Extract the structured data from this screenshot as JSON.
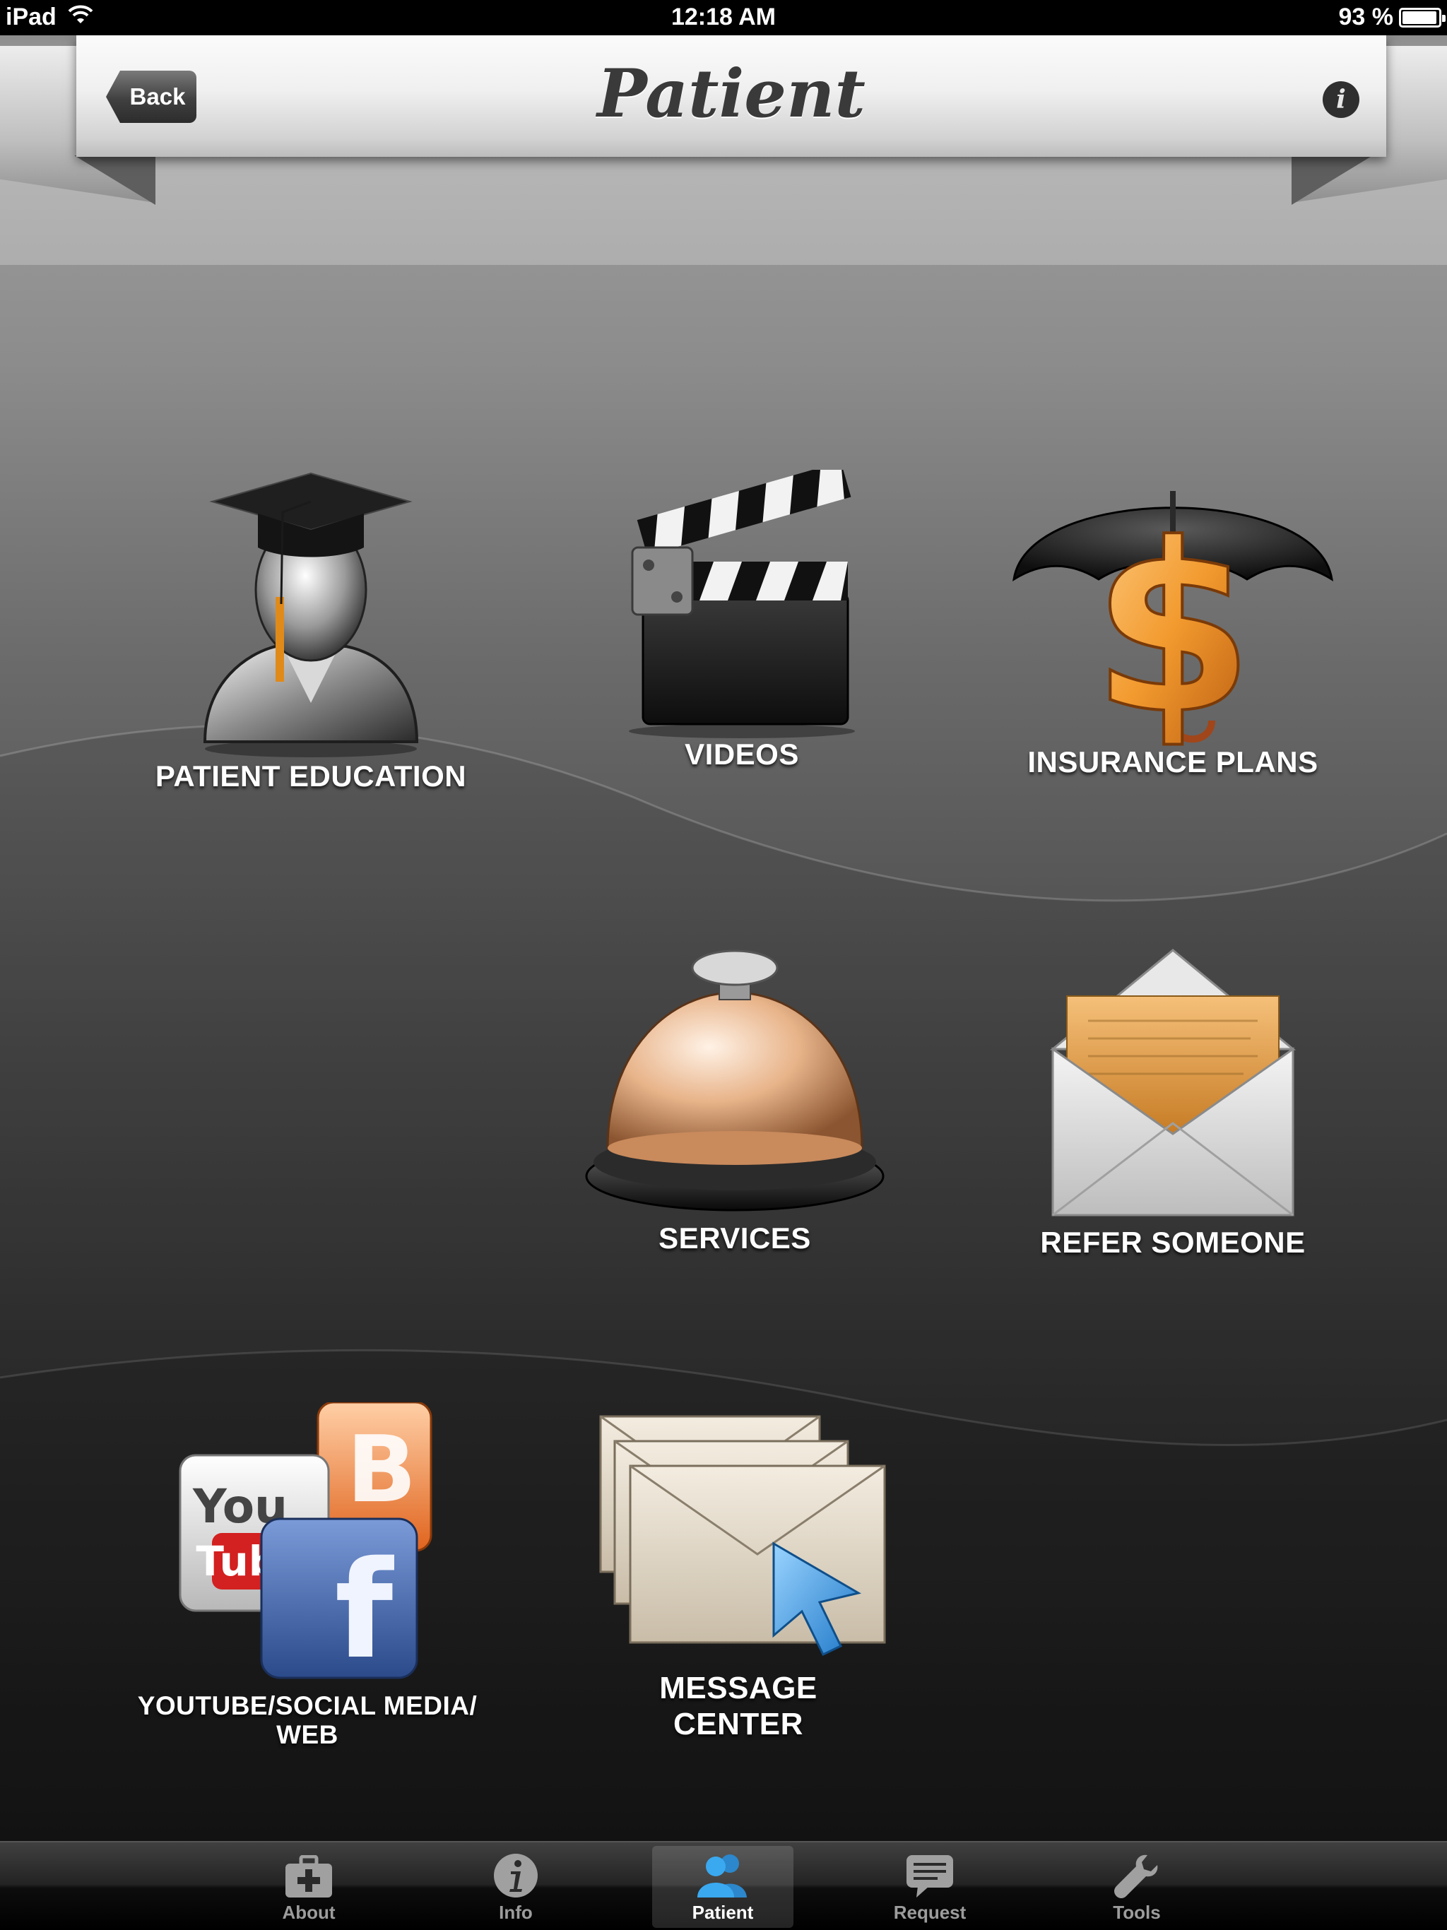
{
  "status_bar": {
    "device": "iPad",
    "time": "12:18 AM",
    "battery": "93 %",
    "battery_level": 0.93
  },
  "header": {
    "title": "Patient",
    "back_label": "Back",
    "info_glyph": "i"
  },
  "tiles": {
    "patient_education": {
      "label": "PATIENT EDUCATION",
      "icon": "graduate-icon"
    },
    "videos": {
      "label": "VIDEOS",
      "icon": "clapperboard-icon"
    },
    "insurance_plans": {
      "label": "INSURANCE PLANS",
      "icon": "umbrella-dollar-icon"
    },
    "services": {
      "label": "SERVICES",
      "icon": "service-bell-icon"
    },
    "refer_someone": {
      "label": "REFER SOMEONE",
      "icon": "open-envelope-icon"
    },
    "social_media": {
      "label_line1": "YOUTUBE/SOCIAL MEDIA/",
      "label_line2": "WEB",
      "icon": "social-media-icon",
      "youtube_text": "You",
      "youtube_tube": "Tube",
      "facebook_text": "f"
    },
    "message_center": {
      "label_line1": "MESSAGE",
      "label_line2": "CENTER",
      "icon": "envelopes-cursor-icon"
    }
  },
  "tab_bar": {
    "tabs": [
      {
        "label": "About",
        "icon": "medical-kit-icon",
        "active": false
      },
      {
        "label": "Info",
        "icon": "info-icon",
        "active": false
      },
      {
        "label": "Patient",
        "icon": "people-icon",
        "active": true
      },
      {
        "label": "Request",
        "icon": "speech-bubble-icon",
        "active": false
      },
      {
        "label": "Tools",
        "icon": "wrench-icon",
        "active": false
      }
    ]
  },
  "colors": {
    "active_tab_icon": "#3aa9f0",
    "dollar_orange": "#f29a2e"
  }
}
